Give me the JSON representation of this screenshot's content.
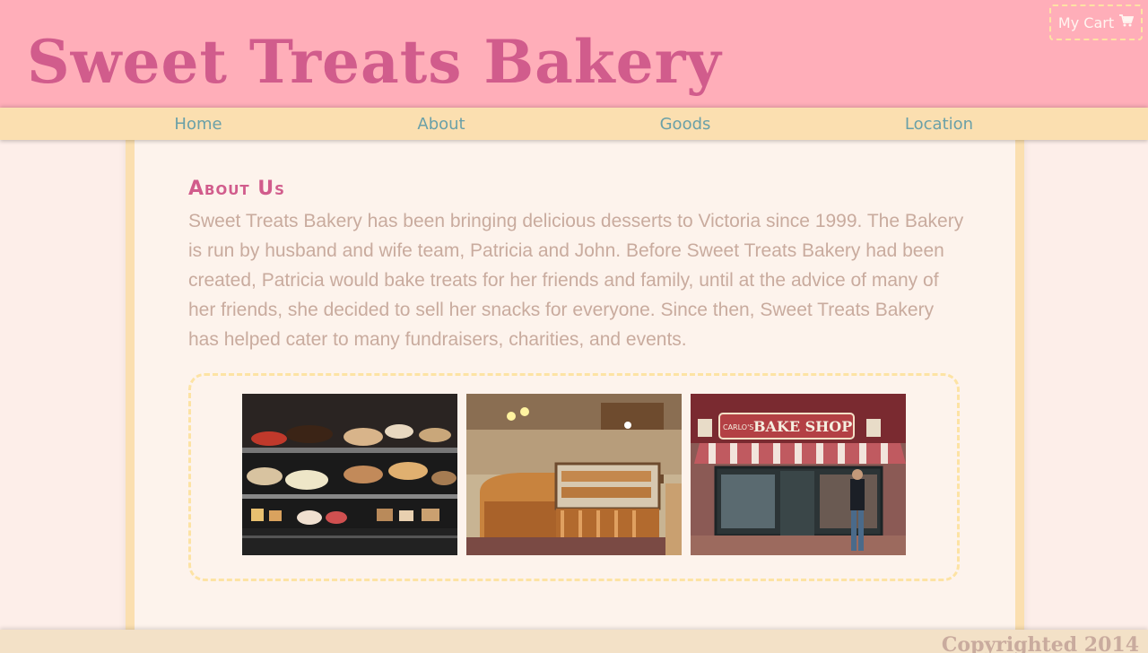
{
  "header": {
    "site_title": "Sweet Treats Bakery",
    "cart_label": "My Cart",
    "cart_icon": "shopping-cart-icon"
  },
  "nav": {
    "items": [
      {
        "label": "Home"
      },
      {
        "label": "About"
      },
      {
        "label": "Goods"
      },
      {
        "label": "Location"
      }
    ]
  },
  "about": {
    "heading": "About Us",
    "body": "Sweet Treats Bakery has been bringing delicious desserts to Victoria since 1999. The Bakery is run by husband and wife team, Patricia and John. Before Sweet Treats Bakery had been created, Patricia would bake treats for her friends and family, until at the advice of many of her friends, she decided to sell her snacks for everyone. Since then, Sweet Treats Bakery has helped cater to many fundraisers, charities, and events."
  },
  "gallery": {
    "photos": [
      {
        "subject": "cake-display-case"
      },
      {
        "subject": "bakery-counter-interior"
      },
      {
        "subject": "bake-shop-storefront",
        "sign_text": "BAKE SHOP",
        "sign_small_text": "CARLO'S"
      }
    ]
  },
  "footer": {
    "copyright": "Copyrighted 2014"
  },
  "colors": {
    "header_bg": "#ffaeb9",
    "title": "#d15c8c",
    "nav_bg": "#fbdfb0",
    "nav_text": "#6aa0a8",
    "body_text": "#c9ab9e",
    "page_bg": "#fdeee9",
    "content_bg": "#fdf3ec"
  }
}
